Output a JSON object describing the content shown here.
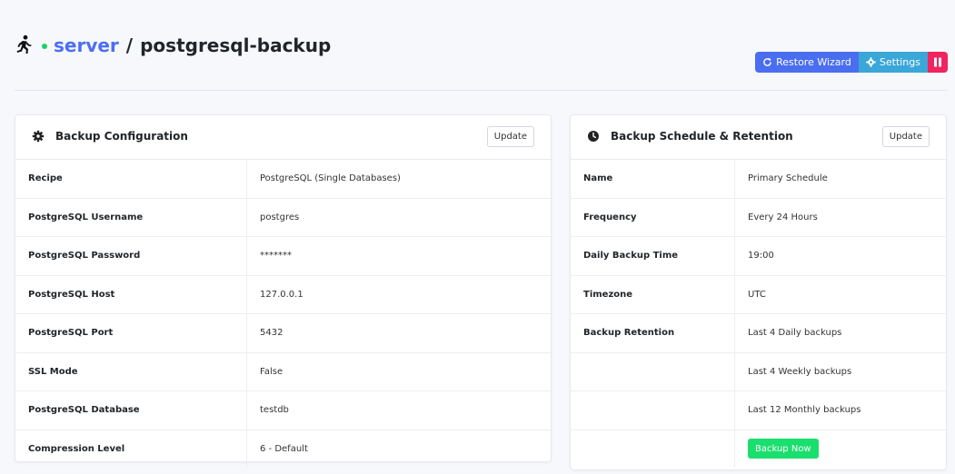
{
  "breadcrumb": {
    "server": "server",
    "separator": "/",
    "current": "postgresql-backup"
  },
  "status_color": "#1ad16a",
  "actions": {
    "restore_wizard": "Restore Wizard",
    "settings": "Settings"
  },
  "backup_config": {
    "title": "Backup Configuration",
    "update": "Update",
    "rows": [
      {
        "key": "Recipe",
        "value": "PostgreSQL (Single Databases)"
      },
      {
        "key": "PostgreSQL Username",
        "value": "postgres"
      },
      {
        "key": "PostgreSQL Password",
        "value": "*******"
      },
      {
        "key": "PostgreSQL Host",
        "value": "127.0.0.1"
      },
      {
        "key": "PostgreSQL Port",
        "value": "5432"
      },
      {
        "key": "SSL Mode",
        "value": "False"
      },
      {
        "key": "PostgreSQL Database",
        "value": "testdb"
      },
      {
        "key": "Compression Level",
        "value": "6 - Default"
      }
    ]
  },
  "schedule": {
    "title": "Backup Schedule & Retention",
    "update": "Update",
    "rows": [
      {
        "key": "Name",
        "value": "Primary Schedule"
      },
      {
        "key": "Frequency",
        "value": "Every 24 Hours"
      },
      {
        "key": "Daily Backup Time",
        "value": "19:00"
      },
      {
        "key": "Timezone",
        "value": "UTC"
      },
      {
        "key": "Backup Retention",
        "value": "Last 4 Daily backups"
      },
      {
        "key": "",
        "value": "Last 4 Weekly backups"
      },
      {
        "key": "",
        "value": "Last 12 Monthly backups"
      }
    ],
    "backup_now": "Backup Now"
  }
}
